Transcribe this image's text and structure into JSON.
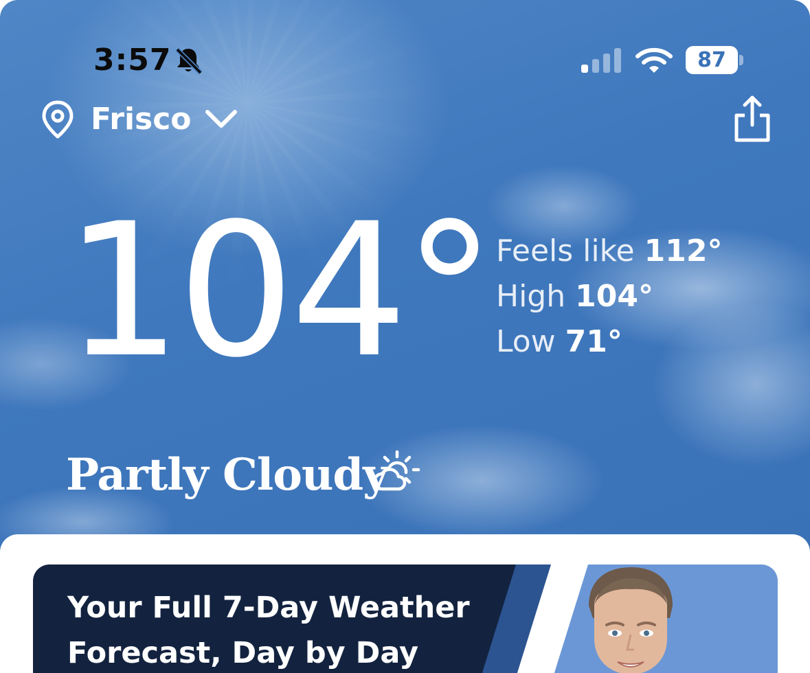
{
  "status_bar": {
    "time": "3:57",
    "battery": "87",
    "icons": [
      "bell-slash-icon",
      "cellular-signal-icon",
      "wifi-icon",
      "battery-icon"
    ]
  },
  "location": {
    "name": "Frisco",
    "icons": [
      "location-pin-icon",
      "chevron-down-icon",
      "share-icon"
    ]
  },
  "current": {
    "temperature": "104°",
    "feels_like_label": "Feels like",
    "feels_like_value": "112°",
    "high_label": "High",
    "high_value": "104°",
    "low_label": "Low",
    "low_value": "71°",
    "condition": "Partly Cloudy",
    "condition_icon": "partly-cloudy-icon"
  },
  "promo": {
    "title_line1": "Your Full 7-Day Weather",
    "title_line2": "Forecast, Day by Day",
    "image": "meteorologist-portrait"
  },
  "colors": {
    "sky": "#3f78bd",
    "promo_dark": "#13233f",
    "promo_stripe": "#2c5491",
    "promo_light": "#6b97d6"
  }
}
